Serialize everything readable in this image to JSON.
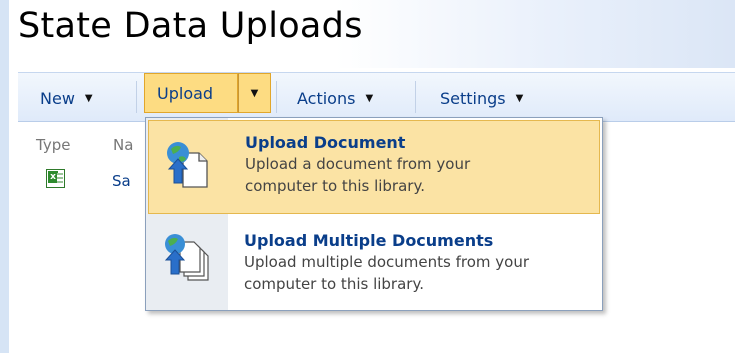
{
  "page": {
    "title": "State Data Uploads"
  },
  "toolbar": {
    "new_label": "New",
    "upload_label": "Upload",
    "actions_label": "Actions",
    "settings_label": "Settings",
    "dropdown_glyph": "▼"
  },
  "list": {
    "columns": [
      "Type",
      "Na"
    ],
    "rows": [
      {
        "type_icon": "excel-file-icon",
        "name": "Sa"
      }
    ]
  },
  "upload_menu": {
    "items": [
      {
        "title": "Upload Document",
        "desc_line1": "Upload a document from your",
        "desc_line2": "computer to this library.",
        "icon": "upload-document-icon",
        "highlighted": true
      },
      {
        "title": "Upload Multiple Documents",
        "desc_line1": "Upload multiple documents from your",
        "desc_line2": "computer to this library.",
        "icon": "upload-multiple-documents-icon",
        "highlighted": false
      }
    ]
  },
  "colors": {
    "accent_text": "#0a3e8a",
    "highlight": "#fbe3a4",
    "toolbar_bg": "#dfeafa"
  }
}
